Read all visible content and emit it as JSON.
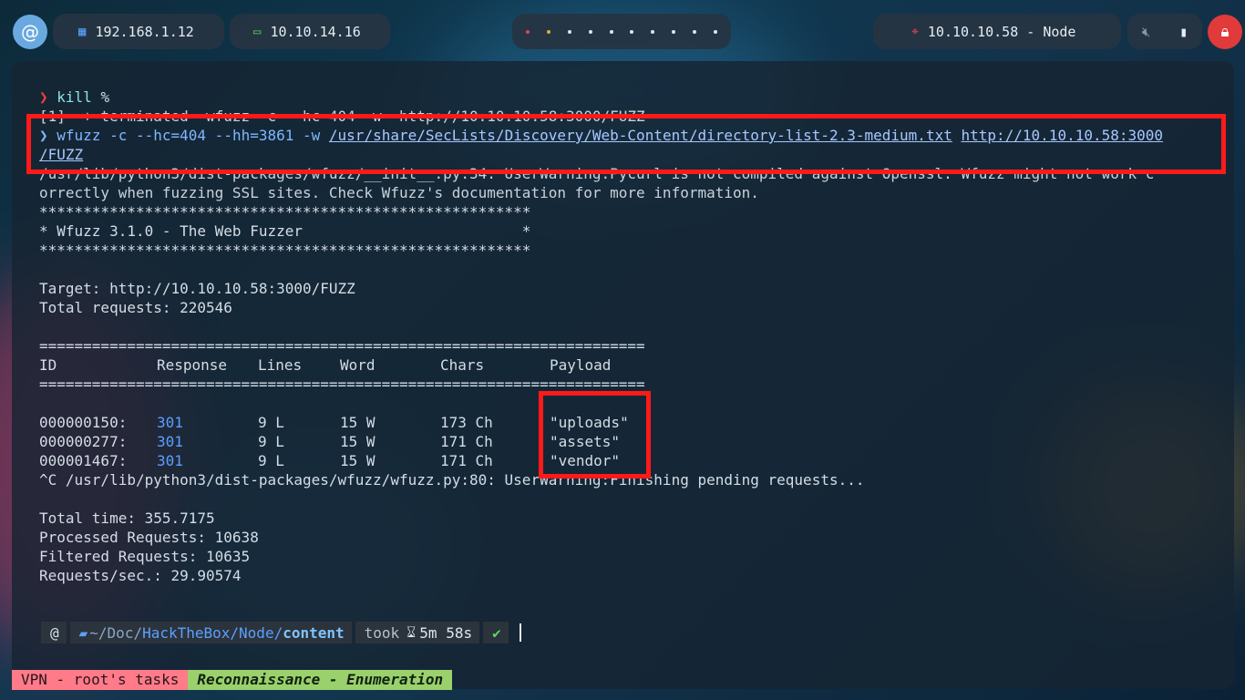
{
  "topbar": {
    "ip_local": "192.168.1.12",
    "ip_vpn": "10.10.14.16",
    "target": "10.10.10.58 - Node",
    "workspace_count": 10
  },
  "terminal": {
    "line_kill_cmd": "kill",
    "line_kill_arg": "%",
    "line_terminated": "[1]  + terminated  wfuzz -c --hc=404 -w  http://10.10.10.58:3000/FUZZ",
    "cmd_prefix": "❯",
    "cmd_main": "wfuzz -c --hc=404 --hh=3861 -w ",
    "cmd_wordlist": "/usr/share/SecLists/Discovery/Web-Content/directory-list-2.3-medium.txt",
    "cmd_url": "http://10.10.10.58:3000",
    "cmd_url_cont": "/FUZZ",
    "warning_1": "/usr/lib/python3/dist-packages/wfuzz/__init__.py:34: UserWarning:Pycurl is not compiled against Openssl. Wfuzz might not work c",
    "warning_2": "orrectly when fuzzing SSL sites. Check Wfuzz's documentation for more information.",
    "banner_stars": "********************************************************",
    "banner_title": "* Wfuzz 3.1.0 - The Web Fuzzer                         *",
    "target_line": "Target: http://10.10.10.58:3000/FUZZ",
    "total_requests": "Total requests: 220546",
    "separator": "=====================================================================",
    "headers": {
      "id": "ID",
      "response": "Response",
      "lines": "Lines",
      "word": "Word",
      "chars": "Chars",
      "payload": "Payload"
    },
    "rows": [
      {
        "id": "000000150:",
        "response": "301",
        "lines": "9 L",
        "word": "15 W",
        "chars": "173 Ch",
        "payload": "\"uploads\""
      },
      {
        "id": "000000277:",
        "response": "301",
        "lines": "9 L",
        "word": "15 W",
        "chars": "171 Ch",
        "payload": "\"assets\""
      },
      {
        "id": "000001467:",
        "response": "301",
        "lines": "9 L",
        "word": "15 W",
        "chars": "171 Ch",
        "payload": "\"vendor\""
      }
    ],
    "interrupt": "^C /usr/lib/python3/dist-packages/wfuzz/wfuzz.py:80: UserWarning:Finishing pending requests...",
    "total_time": "Total time: 355.7175",
    "processed": "Processed Requests: 10638",
    "filtered": "Filtered Requests: 10635",
    "rate": "Requests/sec.: 29.90574"
  },
  "prompt": {
    "path_prefix": "~/Doc/",
    "path_mid": "HackTheBox/Node/",
    "path_last": "content",
    "took_label": "took",
    "duration": "5m 58s",
    "check": "✔"
  },
  "statusline": {
    "session": "VPN - root's tasks",
    "window": "Reconnaissance - Enumeration"
  }
}
